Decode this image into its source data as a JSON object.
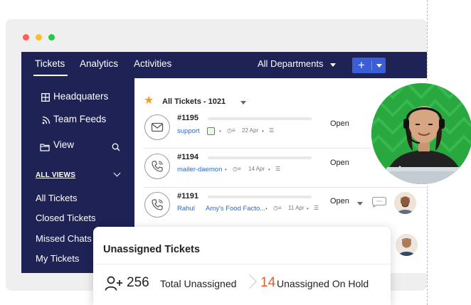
{
  "window": {
    "traffic_lights": [
      "#ff5f57",
      "#febc2e",
      "#28c840"
    ]
  },
  "topbar": {
    "tabs": [
      {
        "label": "Tickets",
        "active": true
      },
      {
        "label": "Analytics"
      },
      {
        "label": "Activities"
      }
    ],
    "department": "All Departments",
    "add_icon": "plus-icon"
  },
  "sidebar": {
    "items": [
      {
        "label": "Headquaters",
        "icon": "grid-icon"
      },
      {
        "label": "Team Feeds",
        "icon": "rss-icon"
      },
      {
        "label": "View",
        "icon": "folder-icon"
      }
    ],
    "all_views_label": "ALL VIEWS",
    "views": [
      "All Tickets",
      "Closed Tickets",
      "Missed Chats",
      "My Tickets"
    ]
  },
  "main": {
    "header": "All Tickets - 1021",
    "tickets": [
      {
        "id": "#1195",
        "channel": "email",
        "contact": "support",
        "account": "",
        "date": "22 Apr",
        "status": "Open"
      },
      {
        "id": "#1194",
        "channel": "phone",
        "contact": "mailer-daemon",
        "account": "",
        "date": "14 Apr",
        "status": "Open"
      },
      {
        "id": "#1191",
        "channel": "phone",
        "contact": "Rahul",
        "account": "Amy's Food Facto...",
        "date": "11 Apr",
        "status": "Open"
      }
    ]
  },
  "popup": {
    "title": "Unassigned Tickets",
    "total_value": "256",
    "total_label": "Total Unassigned",
    "hold_value": "14",
    "hold_label": "Unassigned On Hold",
    "hold_color": "#f15a24"
  },
  "colors": {
    "nav_bg": "#1f2254",
    "accent": "#3b5ed8",
    "link": "#2d6ac8",
    "star": "#f0a020",
    "avatar_bg": "#2aa840"
  }
}
